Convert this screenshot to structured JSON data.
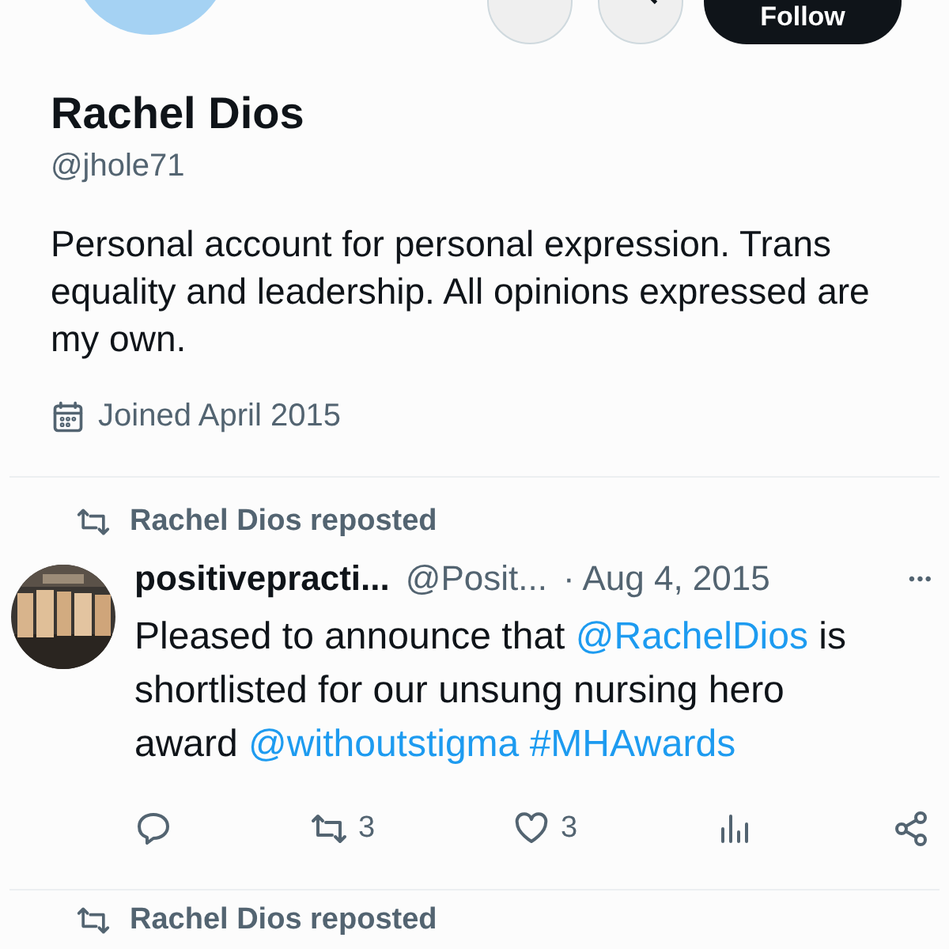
{
  "profile": {
    "follow_button": "Follow",
    "name": "Rachel Dios",
    "handle": "@jhole71",
    "bio": "Personal account for personal expression. Trans equality and leadership. All opinions expressed are my own.",
    "joined": "Joined April 2015"
  },
  "posts": [
    {
      "repost_label": "Rachel Dios reposted",
      "author": "positivepracti...",
      "author_handle": "@Posit...",
      "date": "· Aug 4, 2015",
      "more": "•••",
      "text": "Pleased to announce that @RachelDios is shortlisted for our unsung nursing hero award @withoutstigma #MHAwards",
      "reposts": "3",
      "likes": "3"
    },
    {
      "repost_label": "Rachel Dios reposted"
    }
  ]
}
